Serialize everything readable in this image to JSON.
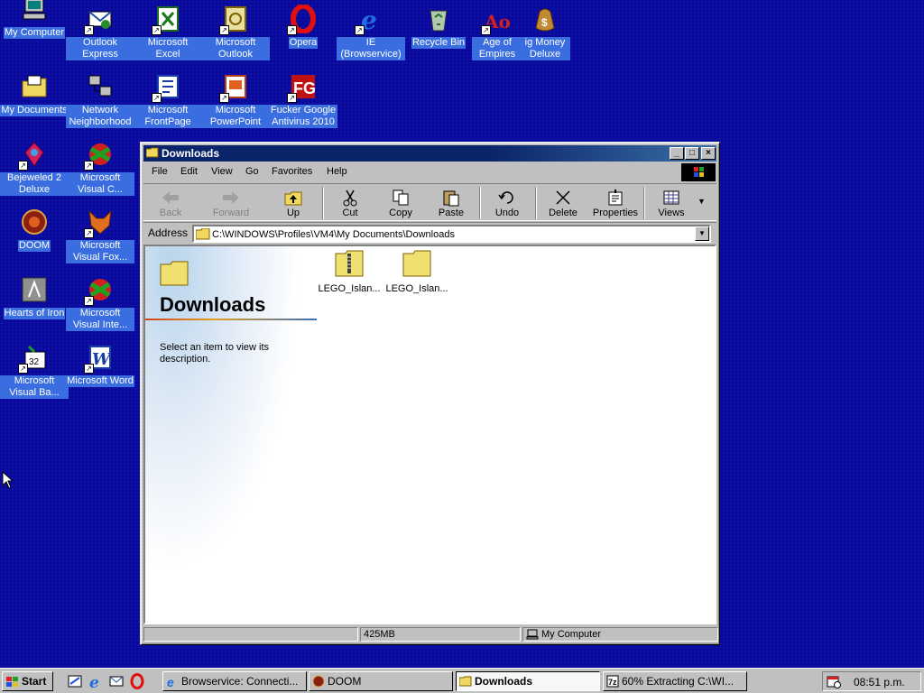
{
  "desktop": {
    "icons": [
      {
        "label": "My Computer",
        "icon": "my-computer-icon"
      },
      {
        "label": "Outlook Express",
        "icon": "outlook-express-icon"
      },
      {
        "label": "Microsoft Excel",
        "icon": "excel-icon"
      },
      {
        "label": "Microsoft Outlook",
        "icon": "outlook-icon"
      },
      {
        "label": "Opera",
        "icon": "opera-icon"
      },
      {
        "label": "IE (Browservice)",
        "icon": "ie-icon"
      },
      {
        "label": "Recycle Bin",
        "icon": "recycle-bin-icon"
      },
      {
        "label": "Age of Empires",
        "icon": "age-of-empires-icon"
      },
      {
        "label": "ig Money Deluxe",
        "icon": "money-icon"
      },
      {
        "label": "My Documents",
        "icon": "my-documents-icon"
      },
      {
        "label": "Network Neighborhood",
        "icon": "network-icon"
      },
      {
        "label": "Microsoft FrontPage",
        "icon": "frontpage-icon"
      },
      {
        "label": "Microsoft PowerPoint",
        "icon": "powerpoint-icon"
      },
      {
        "label": "Fucker Google Antivirus 2010",
        "icon": "antivirus-icon"
      },
      {
        "label": "Bejeweled 2 Deluxe",
        "icon": "bejeweled-icon"
      },
      {
        "label": "Microsoft Visual C...",
        "icon": "visual-c-icon"
      },
      {
        "label": "DOOM",
        "icon": "doom-icon"
      },
      {
        "label": "Microsoft Visual Fox...",
        "icon": "visual-fox-icon"
      },
      {
        "label": "Hearts of Iron",
        "icon": "hearts-of-iron-icon"
      },
      {
        "label": "Microsoft Visual Inte...",
        "icon": "visual-inte-icon"
      },
      {
        "label": "Microsoft Visual Ba...",
        "icon": "visual-basic-icon"
      },
      {
        "label": "Microsoft Word",
        "icon": "word-icon"
      }
    ]
  },
  "window": {
    "title": "Downloads",
    "menu": [
      "File",
      "Edit",
      "View",
      "Go",
      "Favorites",
      "Help"
    ],
    "toolbar": [
      "Back",
      "Forward",
      "Up",
      "Cut",
      "Copy",
      "Paste",
      "Undo",
      "Delete",
      "Properties",
      "Views"
    ],
    "address_label": "Address",
    "address": "C:\\WINDOWS\\Profiles\\VM4\\My Documents\\Downloads",
    "panel_title": "Downloads",
    "panel_desc": "Select an item to view its description.",
    "files": [
      {
        "label": "LEGO_Islan...",
        "icon": "zip-folder-icon"
      },
      {
        "label": "LEGO_Islan...",
        "icon": "folder-icon"
      }
    ],
    "status_size": "425MB",
    "status_zone": "My Computer"
  },
  "taskbar": {
    "start": "Start",
    "tasks": [
      {
        "label": "Browservice: Connecti..."
      },
      {
        "label": "DOOM"
      },
      {
        "label": "Downloads"
      },
      {
        "label": "60% Extracting C:\\WI..."
      }
    ],
    "clock": "08:51 p.m."
  },
  "colors": {
    "desktop": "#0a0a9a",
    "titlebar": "#0a246a",
    "icon_label_bg": "#3a6ee0"
  }
}
